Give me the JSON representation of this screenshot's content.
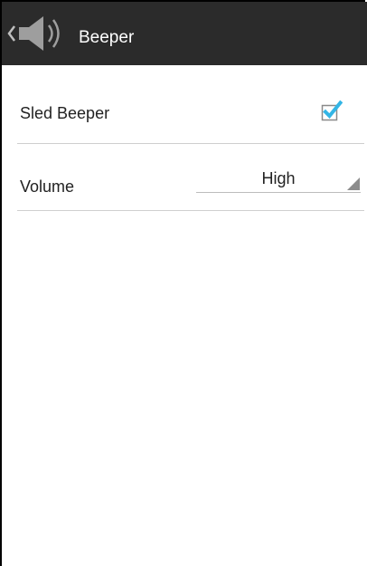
{
  "action_bar": {
    "title": "Beeper",
    "icon": "speaker-volume-icon",
    "background_color": "#2b2b2b"
  },
  "settings": {
    "sled_beeper": {
      "label": "Sled Beeper",
      "checked": true,
      "check_color": "#33b5e5"
    },
    "volume": {
      "label": "Volume",
      "selected": "High"
    }
  }
}
